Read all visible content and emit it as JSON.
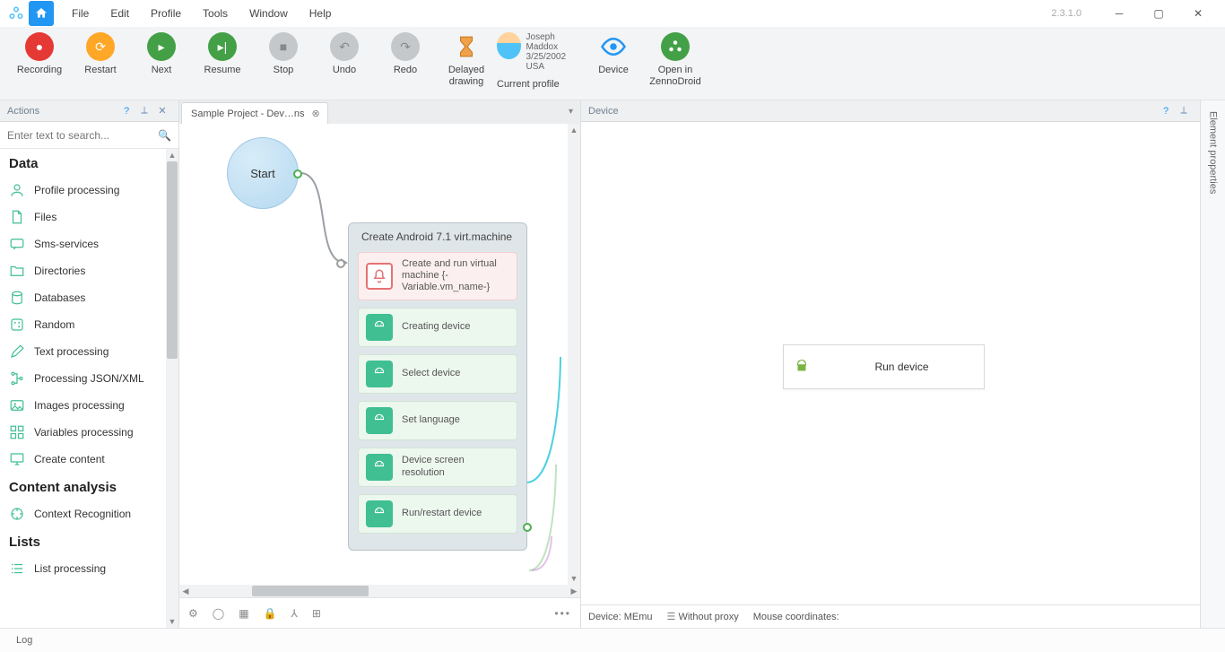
{
  "app": {
    "version": "2.3.1.0"
  },
  "menu": [
    "File",
    "Edit",
    "Profile",
    "Tools",
    "Window",
    "Help"
  ],
  "ribbon": {
    "recording": "Recording",
    "restart": "Restart",
    "next": "Next",
    "resume": "Resume",
    "stop": "Stop",
    "undo": "Undo",
    "redo": "Redo",
    "delayed": "Delayed\ndrawing",
    "current_profile": "Current profile",
    "device": "Device",
    "open_in": "Open in\nZennoDroid",
    "profile": {
      "name": "Joseph Maddox",
      "date": "3/25/2002",
      "country": "USA"
    }
  },
  "panels": {
    "actions": {
      "title": "Actions",
      "search_placeholder": "Enter text to search..."
    },
    "device": {
      "title": "Device"
    },
    "right_rail": "Element properties",
    "log": "Log"
  },
  "actions_groups": [
    {
      "header": "Data",
      "items": [
        {
          "label": "Profile processing",
          "icon": "profile"
        },
        {
          "label": "Files",
          "icon": "file"
        },
        {
          "label": "Sms-services",
          "icon": "sms"
        },
        {
          "label": "Directories",
          "icon": "folder"
        },
        {
          "label": "Databases",
          "icon": "db"
        },
        {
          "label": "Random",
          "icon": "random"
        },
        {
          "label": "Text processing",
          "icon": "pencil"
        },
        {
          "label": "Processing JSON/XML",
          "icon": "tree"
        },
        {
          "label": "Images processing",
          "icon": "image"
        },
        {
          "label": "Variables processing",
          "icon": "vars"
        },
        {
          "label": "Create content",
          "icon": "monitor"
        }
      ]
    },
    {
      "header": "Content analysis",
      "items": [
        {
          "label": "Context Recognition",
          "icon": "context"
        }
      ]
    },
    {
      "header": "Lists",
      "items": [
        {
          "label": "List processing",
          "icon": "list"
        }
      ]
    }
  ],
  "tab": {
    "label": "Sample Project - Dev…ns"
  },
  "canvas": {
    "start": "Start",
    "group_title": "Create Android 7.1 virt.machine",
    "steps": [
      {
        "kind": "alarm",
        "text": "Create and run virtual machine {-Variable.vm_name-}"
      },
      {
        "kind": "android",
        "text": "Creating device"
      },
      {
        "kind": "android",
        "text": "Select device"
      },
      {
        "kind": "android",
        "text": "Set language"
      },
      {
        "kind": "android",
        "text": "Device screen resolution"
      },
      {
        "kind": "android",
        "text": "Run/restart device"
      }
    ]
  },
  "device_card": {
    "label": "Run device"
  },
  "status": {
    "device": "Device: MEmu",
    "proxy": "Without proxy",
    "mouse": "Mouse coordinates:"
  }
}
